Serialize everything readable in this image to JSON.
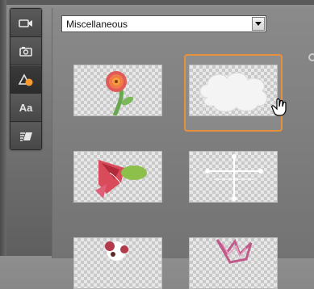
{
  "toolbar": {
    "items": [
      {
        "icon": "video-camera-icon",
        "label": ""
      },
      {
        "icon": "photo-camera-icon",
        "label": ""
      },
      {
        "icon": "shapes-icon",
        "label": "",
        "active": true
      },
      {
        "icon": "text-icon",
        "label": "Aa"
      },
      {
        "icon": "transition-icon",
        "label": ""
      }
    ]
  },
  "category_select": {
    "value": "Miscellaneous"
  },
  "thumbnails": [
    {
      "name": "flower",
      "selected": false
    },
    {
      "name": "cloud",
      "selected": true
    },
    {
      "name": "fish",
      "selected": false
    },
    {
      "name": "cross-lines",
      "selected": false
    },
    {
      "name": "skull",
      "selected": false
    },
    {
      "name": "star",
      "selected": false
    }
  ],
  "colors": {
    "accent": "#e8913c",
    "toolbar_bg": "#3f3f3f",
    "panel_bg": "#7c7c7c"
  }
}
